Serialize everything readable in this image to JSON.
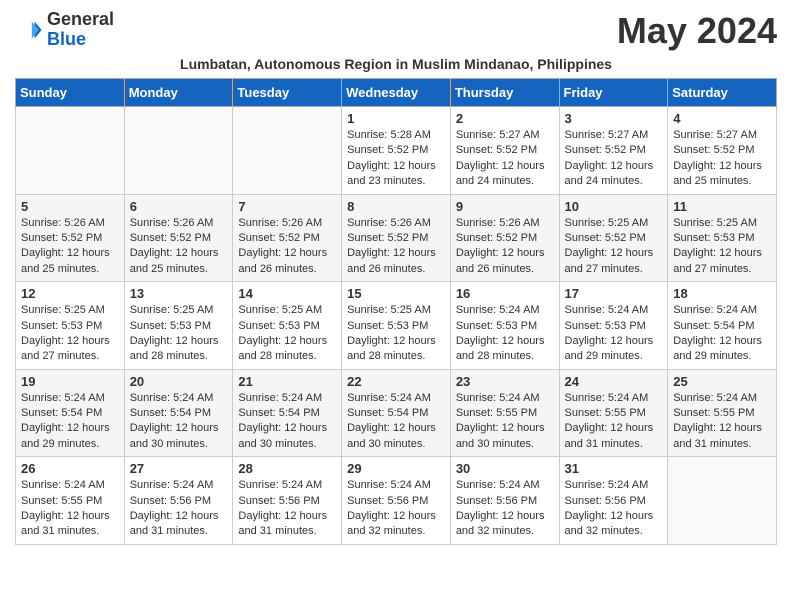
{
  "header": {
    "logo_general": "General",
    "logo_blue": "Blue",
    "month_title": "May 2024",
    "location": "Lumbatan, Autonomous Region in Muslim Mindanao, Philippines"
  },
  "weekdays": [
    "Sunday",
    "Monday",
    "Tuesday",
    "Wednesday",
    "Thursday",
    "Friday",
    "Saturday"
  ],
  "weeks": [
    [
      {
        "day": "",
        "sunrise": "",
        "sunset": "",
        "daylight": ""
      },
      {
        "day": "",
        "sunrise": "",
        "sunset": "",
        "daylight": ""
      },
      {
        "day": "",
        "sunrise": "",
        "sunset": "",
        "daylight": ""
      },
      {
        "day": "1",
        "sunrise": "Sunrise: 5:28 AM",
        "sunset": "Sunset: 5:52 PM",
        "daylight": "Daylight: 12 hours and 23 minutes."
      },
      {
        "day": "2",
        "sunrise": "Sunrise: 5:27 AM",
        "sunset": "Sunset: 5:52 PM",
        "daylight": "Daylight: 12 hours and 24 minutes."
      },
      {
        "day": "3",
        "sunrise": "Sunrise: 5:27 AM",
        "sunset": "Sunset: 5:52 PM",
        "daylight": "Daylight: 12 hours and 24 minutes."
      },
      {
        "day": "4",
        "sunrise": "Sunrise: 5:27 AM",
        "sunset": "Sunset: 5:52 PM",
        "daylight": "Daylight: 12 hours and 25 minutes."
      }
    ],
    [
      {
        "day": "5",
        "sunrise": "Sunrise: 5:26 AM",
        "sunset": "Sunset: 5:52 PM",
        "daylight": "Daylight: 12 hours and 25 minutes."
      },
      {
        "day": "6",
        "sunrise": "Sunrise: 5:26 AM",
        "sunset": "Sunset: 5:52 PM",
        "daylight": "Daylight: 12 hours and 25 minutes."
      },
      {
        "day": "7",
        "sunrise": "Sunrise: 5:26 AM",
        "sunset": "Sunset: 5:52 PM",
        "daylight": "Daylight: 12 hours and 26 minutes."
      },
      {
        "day": "8",
        "sunrise": "Sunrise: 5:26 AM",
        "sunset": "Sunset: 5:52 PM",
        "daylight": "Daylight: 12 hours and 26 minutes."
      },
      {
        "day": "9",
        "sunrise": "Sunrise: 5:26 AM",
        "sunset": "Sunset: 5:52 PM",
        "daylight": "Daylight: 12 hours and 26 minutes."
      },
      {
        "day": "10",
        "sunrise": "Sunrise: 5:25 AM",
        "sunset": "Sunset: 5:52 PM",
        "daylight": "Daylight: 12 hours and 27 minutes."
      },
      {
        "day": "11",
        "sunrise": "Sunrise: 5:25 AM",
        "sunset": "Sunset: 5:53 PM",
        "daylight": "Daylight: 12 hours and 27 minutes."
      }
    ],
    [
      {
        "day": "12",
        "sunrise": "Sunrise: 5:25 AM",
        "sunset": "Sunset: 5:53 PM",
        "daylight": "Daylight: 12 hours and 27 minutes."
      },
      {
        "day": "13",
        "sunrise": "Sunrise: 5:25 AM",
        "sunset": "Sunset: 5:53 PM",
        "daylight": "Daylight: 12 hours and 28 minutes."
      },
      {
        "day": "14",
        "sunrise": "Sunrise: 5:25 AM",
        "sunset": "Sunset: 5:53 PM",
        "daylight": "Daylight: 12 hours and 28 minutes."
      },
      {
        "day": "15",
        "sunrise": "Sunrise: 5:25 AM",
        "sunset": "Sunset: 5:53 PM",
        "daylight": "Daylight: 12 hours and 28 minutes."
      },
      {
        "day": "16",
        "sunrise": "Sunrise: 5:24 AM",
        "sunset": "Sunset: 5:53 PM",
        "daylight": "Daylight: 12 hours and 28 minutes."
      },
      {
        "day": "17",
        "sunrise": "Sunrise: 5:24 AM",
        "sunset": "Sunset: 5:53 PM",
        "daylight": "Daylight: 12 hours and 29 minutes."
      },
      {
        "day": "18",
        "sunrise": "Sunrise: 5:24 AM",
        "sunset": "Sunset: 5:54 PM",
        "daylight": "Daylight: 12 hours and 29 minutes."
      }
    ],
    [
      {
        "day": "19",
        "sunrise": "Sunrise: 5:24 AM",
        "sunset": "Sunset: 5:54 PM",
        "daylight": "Daylight: 12 hours and 29 minutes."
      },
      {
        "day": "20",
        "sunrise": "Sunrise: 5:24 AM",
        "sunset": "Sunset: 5:54 PM",
        "daylight": "Daylight: 12 hours and 30 minutes."
      },
      {
        "day": "21",
        "sunrise": "Sunrise: 5:24 AM",
        "sunset": "Sunset: 5:54 PM",
        "daylight": "Daylight: 12 hours and 30 minutes."
      },
      {
        "day": "22",
        "sunrise": "Sunrise: 5:24 AM",
        "sunset": "Sunset: 5:54 PM",
        "daylight": "Daylight: 12 hours and 30 minutes."
      },
      {
        "day": "23",
        "sunrise": "Sunrise: 5:24 AM",
        "sunset": "Sunset: 5:55 PM",
        "daylight": "Daylight: 12 hours and 30 minutes."
      },
      {
        "day": "24",
        "sunrise": "Sunrise: 5:24 AM",
        "sunset": "Sunset: 5:55 PM",
        "daylight": "Daylight: 12 hours and 31 minutes."
      },
      {
        "day": "25",
        "sunrise": "Sunrise: 5:24 AM",
        "sunset": "Sunset: 5:55 PM",
        "daylight": "Daylight: 12 hours and 31 minutes."
      }
    ],
    [
      {
        "day": "26",
        "sunrise": "Sunrise: 5:24 AM",
        "sunset": "Sunset: 5:55 PM",
        "daylight": "Daylight: 12 hours and 31 minutes."
      },
      {
        "day": "27",
        "sunrise": "Sunrise: 5:24 AM",
        "sunset": "Sunset: 5:56 PM",
        "daylight": "Daylight: 12 hours and 31 minutes."
      },
      {
        "day": "28",
        "sunrise": "Sunrise: 5:24 AM",
        "sunset": "Sunset: 5:56 PM",
        "daylight": "Daylight: 12 hours and 31 minutes."
      },
      {
        "day": "29",
        "sunrise": "Sunrise: 5:24 AM",
        "sunset": "Sunset: 5:56 PM",
        "daylight": "Daylight: 12 hours and 32 minutes."
      },
      {
        "day": "30",
        "sunrise": "Sunrise: 5:24 AM",
        "sunset": "Sunset: 5:56 PM",
        "daylight": "Daylight: 12 hours and 32 minutes."
      },
      {
        "day": "31",
        "sunrise": "Sunrise: 5:24 AM",
        "sunset": "Sunset: 5:56 PM",
        "daylight": "Daylight: 12 hours and 32 minutes."
      },
      {
        "day": "",
        "sunrise": "",
        "sunset": "",
        "daylight": ""
      }
    ]
  ]
}
